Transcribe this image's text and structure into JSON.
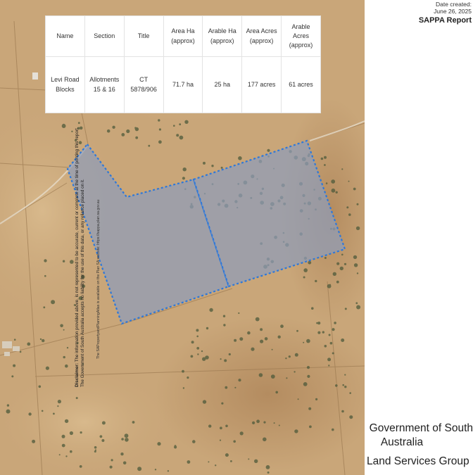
{
  "report": {
    "date_label": "Date created:",
    "date_value": "June 26, 2025",
    "title": "SAPPA Report"
  },
  "table": {
    "headers": [
      "Name",
      "Section",
      "Title",
      "Area Ha (approx)",
      "Arable Ha (approx)",
      "Area Acres (approx)",
      "Arable Acres (approx)"
    ],
    "rows": [
      [
        "Levi Road Blocks",
        "Allotments 15 & 16",
        "CT 5878/906",
        "71.7 ha",
        "25 ha",
        "177 acres",
        "61 acres"
      ]
    ]
  },
  "disclaimer": {
    "label": "Disclaimer:",
    "line1": "The information provided above, is not represented to be accurate, current or complete at the time of printing this report.",
    "line2": "The Government of South Australia accepts no liability for the use of this data, or any reliance placed on it.",
    "line3": "The SAPropertyandPlanningAtlas is available on the Plan SA website: https://sappa.plan.sa.gov.au"
  },
  "footer": {
    "line1": "Government of South",
    "line2": "Australia",
    "line3": "Land Services Group"
  },
  "colors": {
    "parcel_fill": "#8f9cb8",
    "parcel_border": "#2f78d8",
    "terrain": "#c9a679"
  }
}
